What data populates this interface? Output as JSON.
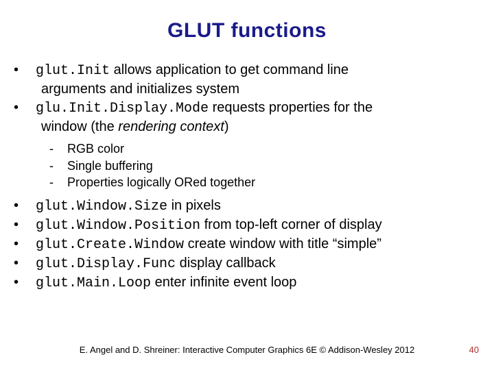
{
  "title": "GLUT functions",
  "items": {
    "i1_code": "glut.Init",
    "i1_rest": " allows application to get command line",
    "i1_cont": "arguments and initializes system",
    "i2_code": "glu.Init.Display.Mode",
    "i2_rest": " requests properties for the",
    "i2_cont_a": "window (the ",
    "i2_cont_ital": "rendering context",
    "i2_cont_b": ")",
    "s1": "RGB color",
    "s2": "Single buffering",
    "s3": "Properties logically ORed together",
    "i3_code": "glut.Window.Size",
    "i3_rest": " in pixels",
    "i4_code": "glut.Window.Position",
    "i4_rest": " from top-left corner of display",
    "i5_code": "glut.Create.Window",
    "i5_rest": " create window with title “simple”",
    "i6_code": "glut.Display.Func",
    "i6_rest": " display callback",
    "i7_code": "glut.Main.Loop",
    "i7_rest": " enter infinite event loop"
  },
  "footer": "E. Angel and D. Shreiner: Interactive Computer Graphics 6E © Addison-Wesley 2012",
  "page": "40"
}
